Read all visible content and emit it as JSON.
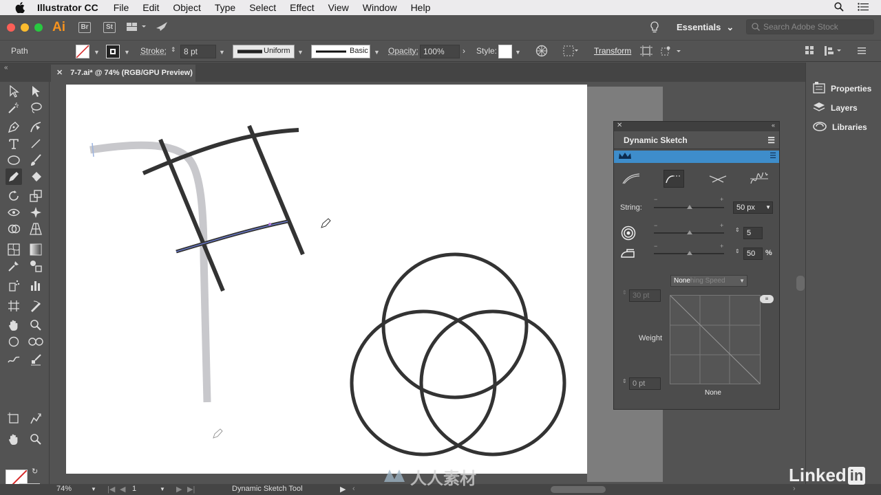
{
  "menubar": {
    "app_name": "Illustrator CC",
    "items": [
      "File",
      "Edit",
      "Object",
      "Type",
      "Select",
      "Effect",
      "View",
      "Window",
      "Help"
    ]
  },
  "appbar": {
    "logo": "Ai",
    "bridge": "Br",
    "stock": "St",
    "workspace": "Essentials",
    "stock_search_placeholder": "Search Adobe Stock"
  },
  "controlbar": {
    "selection_label": "Path",
    "stroke_label": "Stroke:",
    "stroke_value": "8 pt",
    "profile_label": "Uniform",
    "brush_label": "Basic",
    "opacity_label": "Opacity:",
    "opacity_value": "100%",
    "style_label": "Style:",
    "transform_label": "Transform"
  },
  "document": {
    "tab_title": "7-7.ai* @ 74% (RGB/GPU Preview)"
  },
  "dynamic_sketch": {
    "title": "Dynamic Sketch",
    "string_label": "String:",
    "string_value": "50 px",
    "value_2": "5",
    "value_3": "50",
    "percent": "%",
    "smoothing_selected": "None",
    "smoothing_placeholder": "hing Speed",
    "max_weight": "30 pt",
    "min_weight": "0 pt",
    "weight_label": "Weight",
    "graph_bottom_label": "None"
  },
  "rightdock": {
    "items": [
      "Properties",
      "Layers",
      "Libraries"
    ]
  },
  "statusbar": {
    "zoom": "74%",
    "artboard": "1",
    "tool": "Dynamic Sketch Tool"
  },
  "watermark": {
    "brand": "Linked",
    "brand_box": "in",
    "center_text": "人人素材"
  },
  "colors": {
    "panel_accent": "#3e8dcb",
    "logo_orange": "#f7931e"
  }
}
